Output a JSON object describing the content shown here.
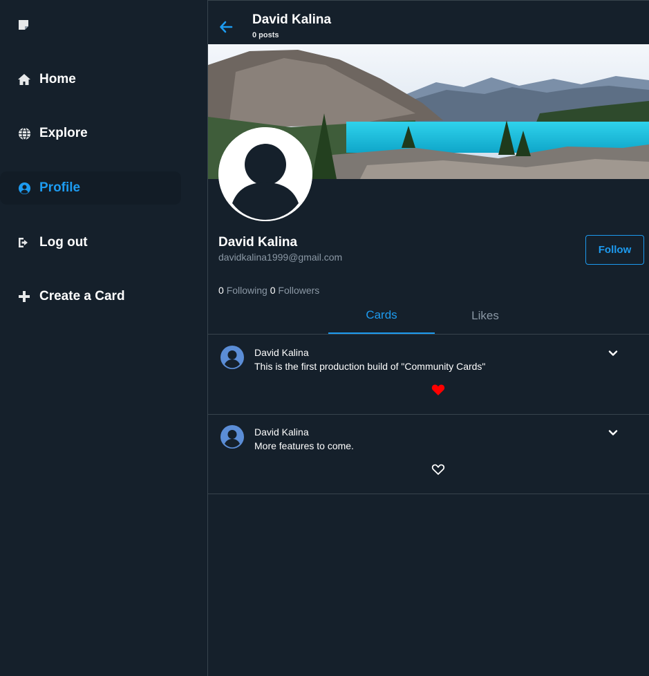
{
  "colors": {
    "background": "#15202b",
    "accent": "#1d9bf0",
    "muted": "#8b98a5",
    "border": "#38444d",
    "liked": "#e0245e",
    "avatar_blue": "#5b8dd6"
  },
  "sidebar": {
    "logo_icon": "note-icon",
    "items": [
      {
        "label": "Home",
        "icon": "home-icon"
      },
      {
        "label": "Explore",
        "icon": "globe-icon"
      },
      {
        "label": "Profile",
        "icon": "user-circle-icon",
        "active": true
      },
      {
        "label": "Log out",
        "icon": "logout-icon"
      },
      {
        "label": "Create a Card",
        "icon": "plus-icon"
      }
    ]
  },
  "header": {
    "title": "David Kalina",
    "subtitle": "0 posts"
  },
  "profile": {
    "name": "David Kalina",
    "email": "davidkalina1999@gmail.com",
    "follow_label": "Follow",
    "following_count": "0",
    "following_label": "Following",
    "followers_count": "0",
    "followers_label": "Followers"
  },
  "tabs": [
    {
      "label": "Cards",
      "active": true
    },
    {
      "label": "Likes",
      "active": false
    }
  ],
  "cards": [
    {
      "author": "David Kalina",
      "text": "This is the first production build of \"Community Cards\"",
      "liked": true
    },
    {
      "author": "David Kalina",
      "text": "More features to come.",
      "liked": false
    }
  ]
}
